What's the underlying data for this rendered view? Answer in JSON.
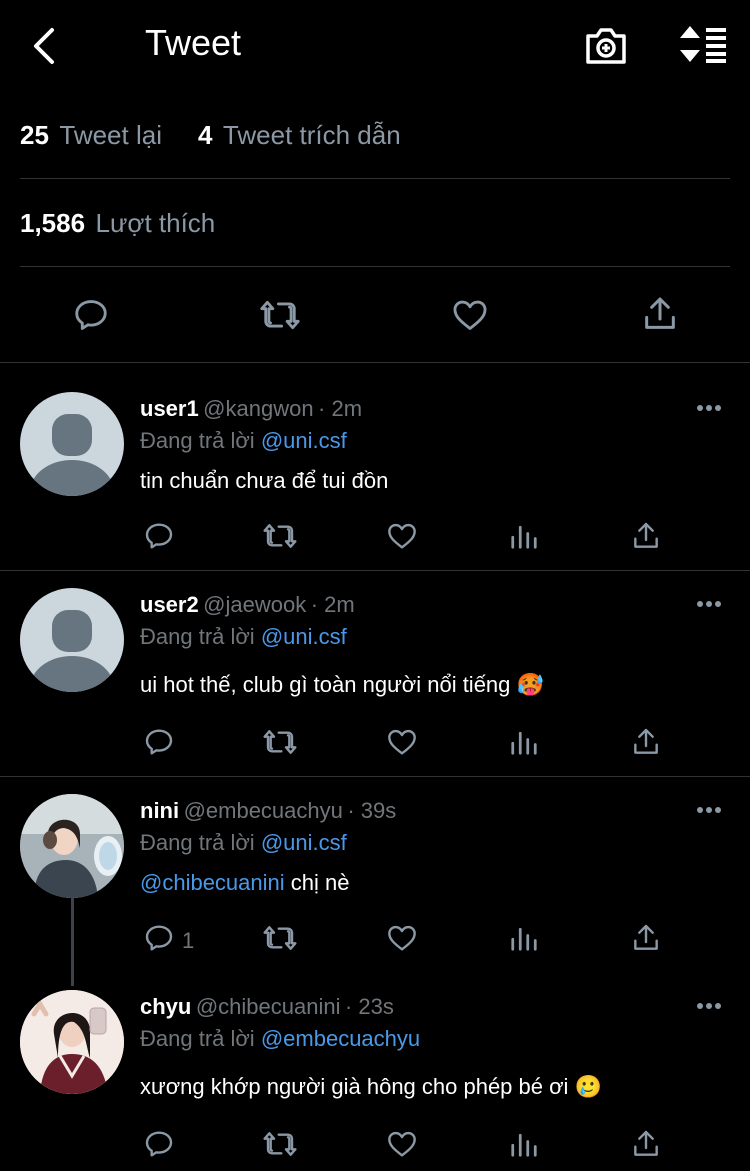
{
  "header": {
    "title": "Tweet"
  },
  "stats": {
    "retweets_num": "25",
    "retweets_label": "Tweet lại",
    "quotes_num": "4",
    "quotes_label": "Tweet trích dẫn",
    "likes_num": "1,586",
    "likes_label": "Lượt thích"
  },
  "colors": {
    "background": "#000000",
    "link": "#4a99e9",
    "muted": "#71767b",
    "divider": "#2f3336"
  },
  "replies": [
    {
      "name": "user1",
      "handle": "@kangwon",
      "time": "· 2m",
      "reply_label": "Đang trả lời",
      "reply_to": "@uni.csf",
      "text": "tin chuẩn chưa để tui đồn",
      "reply_count": ""
    },
    {
      "name": "user2",
      "handle": "@jaewook",
      "time": "· 2m",
      "reply_label": "Đang trả lời",
      "reply_to": "@uni.csf",
      "text": "ui hot thế, club gì toàn người nổi tiếng",
      "emoji": "🥵",
      "reply_count": ""
    },
    {
      "name": "nini",
      "handle": "@embecuachyu",
      "time": "· 39s",
      "reply_label": "Đang trả lời",
      "reply_to": "@uni.csf",
      "mention_text": "@chibecuanini",
      "text": " chị nè",
      "reply_count": "1"
    },
    {
      "name": "chyu",
      "handle": "@chibecuanini",
      "time": "· 23s",
      "reply_label": "Đang trả lời",
      "reply_to": "@embecuachyu",
      "text": "xương khớp người già hông cho phép bé ơi",
      "emoji": "🥲",
      "reply_count": ""
    }
  ]
}
